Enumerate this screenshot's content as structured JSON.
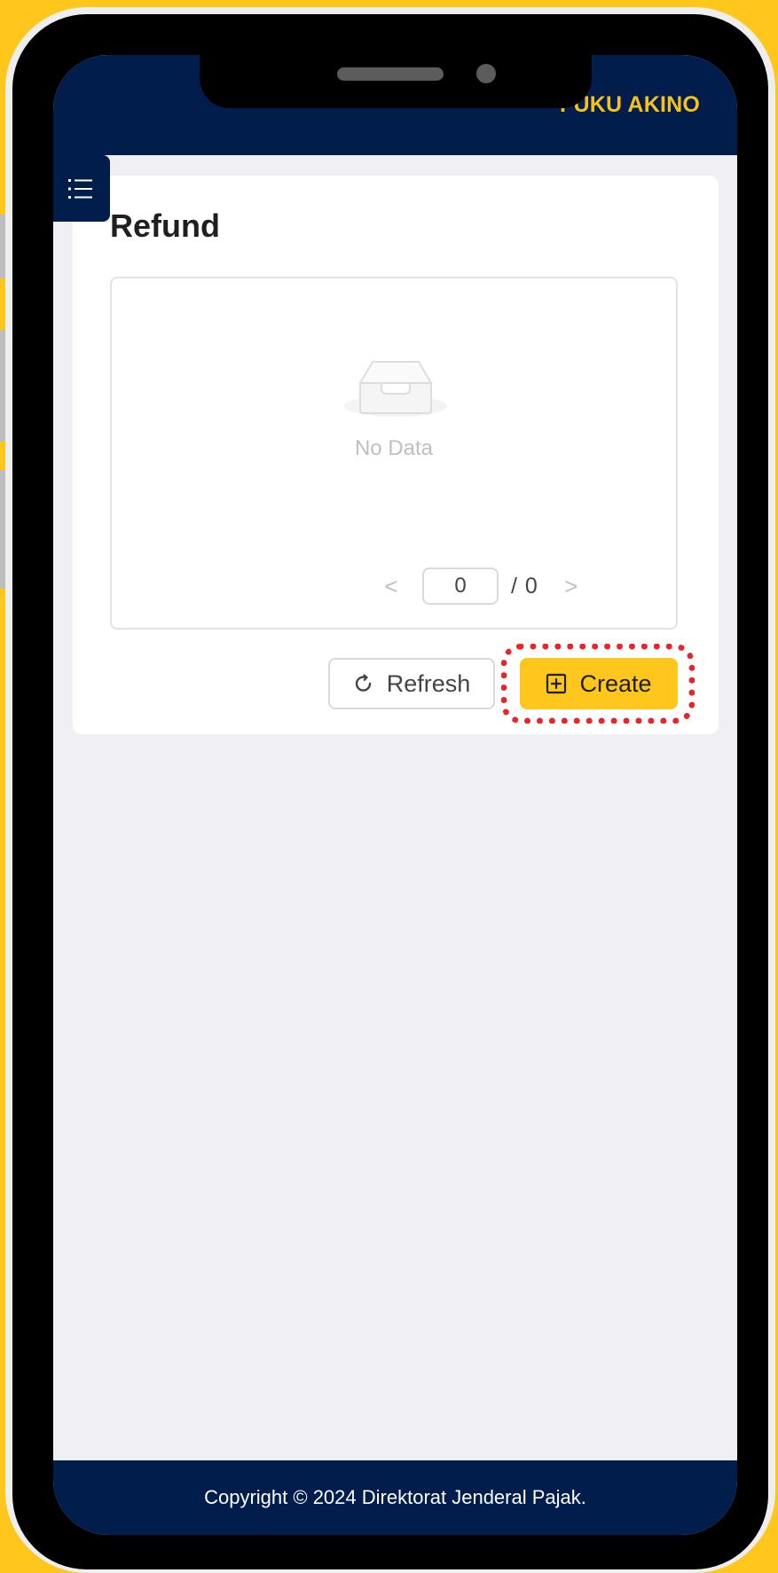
{
  "header": {
    "user_name": "FUKU AKINO"
  },
  "page": {
    "title": "Refund"
  },
  "list": {
    "empty_text": "No Data"
  },
  "pagination": {
    "current_page": "0",
    "total": "/ 0",
    "prev_symbol": "<",
    "next_symbol": ">"
  },
  "actions": {
    "refresh_label": "Refresh",
    "create_label": "Create"
  },
  "footer": {
    "copyright": "Copyright © 2024 Direktorat Jenderal Pajak."
  },
  "colors": {
    "navy": "#011D4B",
    "accent_yellow": "#FFC61C",
    "highlight_red": "#E8252A"
  },
  "icons": {
    "menu": "list-icon",
    "empty": "empty-inbox-icon",
    "refresh": "refresh-icon",
    "create": "plus-square-icon"
  }
}
